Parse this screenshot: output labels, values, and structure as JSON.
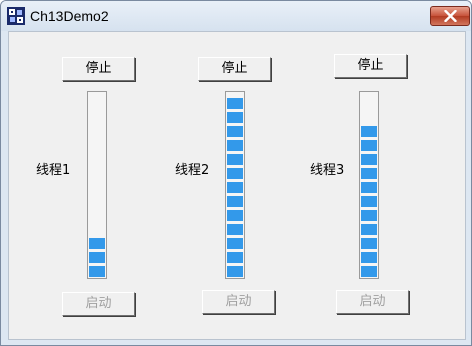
{
  "window": {
    "title": "Ch13Demo2"
  },
  "threads": [
    {
      "label": "线程1",
      "stop_label": "停止",
      "start_label": "启动",
      "progress_percent": 22
    },
    {
      "label": "线程2",
      "stop_label": "停止",
      "start_label": "启动",
      "progress_percent": 100
    },
    {
      "label": "线程3",
      "stop_label": "停止",
      "start_label": "启动",
      "progress_percent": 82
    }
  ],
  "colors": {
    "progress": "#3399ea",
    "client_bg": "#f0f0f0",
    "close_button": "#c7523a"
  },
  "icons": {
    "app": "app-icon",
    "close": "close-icon"
  }
}
